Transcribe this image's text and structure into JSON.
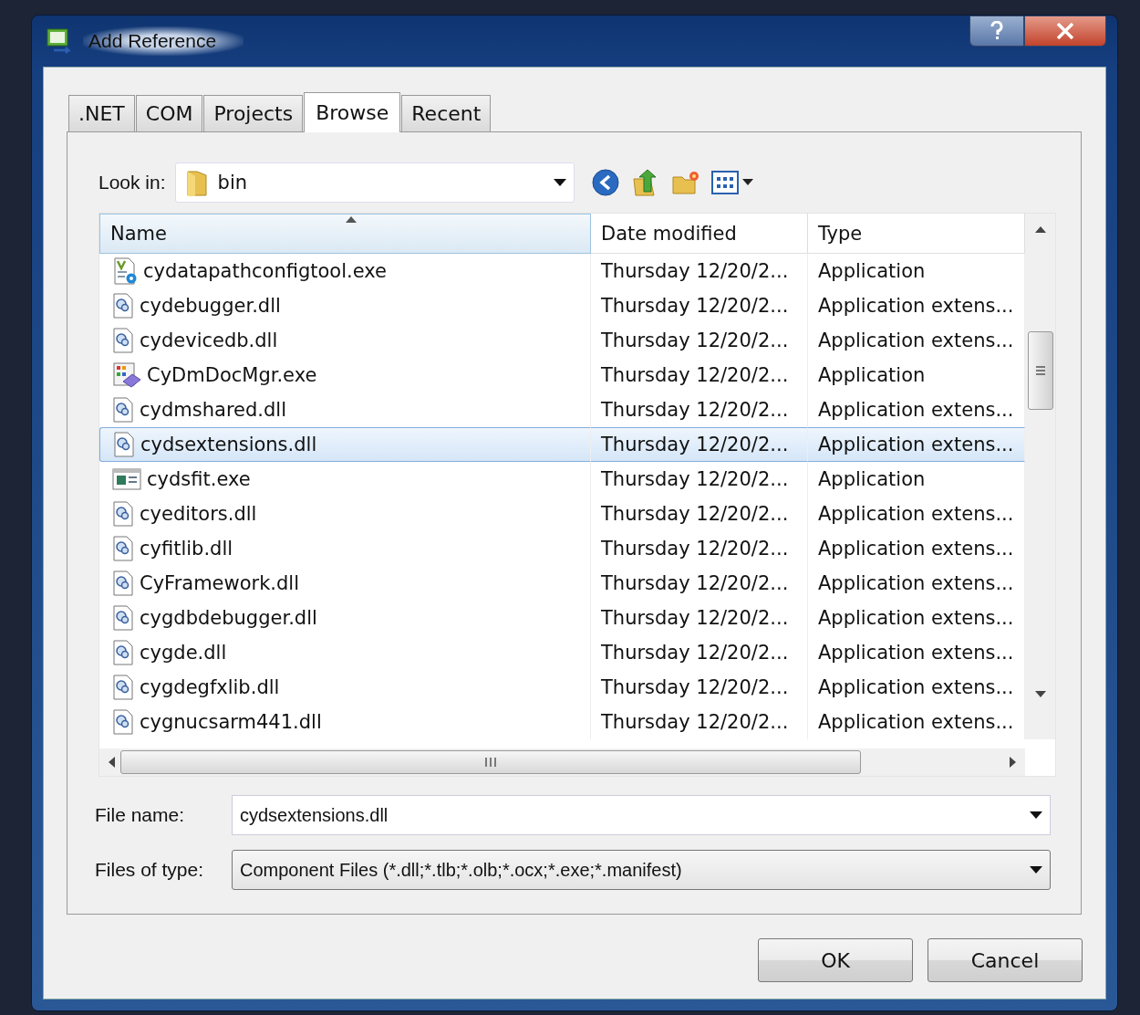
{
  "window": {
    "title": "Add Reference"
  },
  "tabs": [
    {
      "label": ".NET",
      "selected": false
    },
    {
      "label": "COM",
      "selected": false
    },
    {
      "label": "Projects",
      "selected": false
    },
    {
      "label": "Browse",
      "selected": true
    },
    {
      "label": "Recent",
      "selected": false
    }
  ],
  "look_in": {
    "label": "Look in:",
    "value": "bin"
  },
  "table": {
    "columns": [
      {
        "label": "Name",
        "sorted": true
      },
      {
        "label": "Date modified",
        "sorted": false
      },
      {
        "label": "Type",
        "sorted": false
      }
    ],
    "rows": [
      {
        "kind": "config",
        "name": "cydatapathconfigtool.exe",
        "date": "Thursday 12/20/2...",
        "type": "Application",
        "selected": false
      },
      {
        "kind": "dll",
        "name": "cydebugger.dll",
        "date": "Thursday 12/20/2...",
        "type": "Application extens...",
        "selected": false
      },
      {
        "kind": "dll",
        "name": "cydevicedb.dll",
        "date": "Thursday 12/20/2...",
        "type": "Application extens...",
        "selected": false
      },
      {
        "kind": "app",
        "name": "CyDmDocMgr.exe",
        "date": "Thursday 12/20/2...",
        "type": "Application",
        "selected": false
      },
      {
        "kind": "dll",
        "name": "cydmshared.dll",
        "date": "Thursday 12/20/2...",
        "type": "Application extens...",
        "selected": false
      },
      {
        "kind": "dll",
        "name": "cydsextensions.dll",
        "date": "Thursday 12/20/2...",
        "type": "Application extens...",
        "selected": true
      },
      {
        "kind": "window",
        "name": "cydsfit.exe",
        "date": "Thursday 12/20/2...",
        "type": "Application",
        "selected": false
      },
      {
        "kind": "dll",
        "name": "cyeditors.dll",
        "date": "Thursday 12/20/2...",
        "type": "Application extens...",
        "selected": false
      },
      {
        "kind": "dll",
        "name": "cyfitlib.dll",
        "date": "Thursday 12/20/2...",
        "type": "Application extens...",
        "selected": false
      },
      {
        "kind": "dll",
        "name": "CyFramework.dll",
        "date": "Thursday 12/20/2...",
        "type": "Application extens...",
        "selected": false
      },
      {
        "kind": "dll",
        "name": "cygdbdebugger.dll",
        "date": "Thursday 12/20/2...",
        "type": "Application extens...",
        "selected": false
      },
      {
        "kind": "dll",
        "name": "cygde.dll",
        "date": "Thursday 12/20/2...",
        "type": "Application extens...",
        "selected": false
      },
      {
        "kind": "dll",
        "name": "cygdegfxlib.dll",
        "date": "Thursday 12/20/2...",
        "type": "Application extens...",
        "selected": false
      },
      {
        "kind": "dll",
        "name": "cygnucsarm441.dll",
        "date": "Thursday 12/20/2...",
        "type": "Application extens...",
        "selected": false
      }
    ]
  },
  "file_name": {
    "label": "File name:",
    "value": "cydsextensions.dll"
  },
  "files_of_type": {
    "label": "Files of type:",
    "value": "Component Files (*.dll;*.tlb;*.olb;*.ocx;*.exe;*.manifest)"
  },
  "buttons": [
    "OK",
    "Cancel"
  ]
}
